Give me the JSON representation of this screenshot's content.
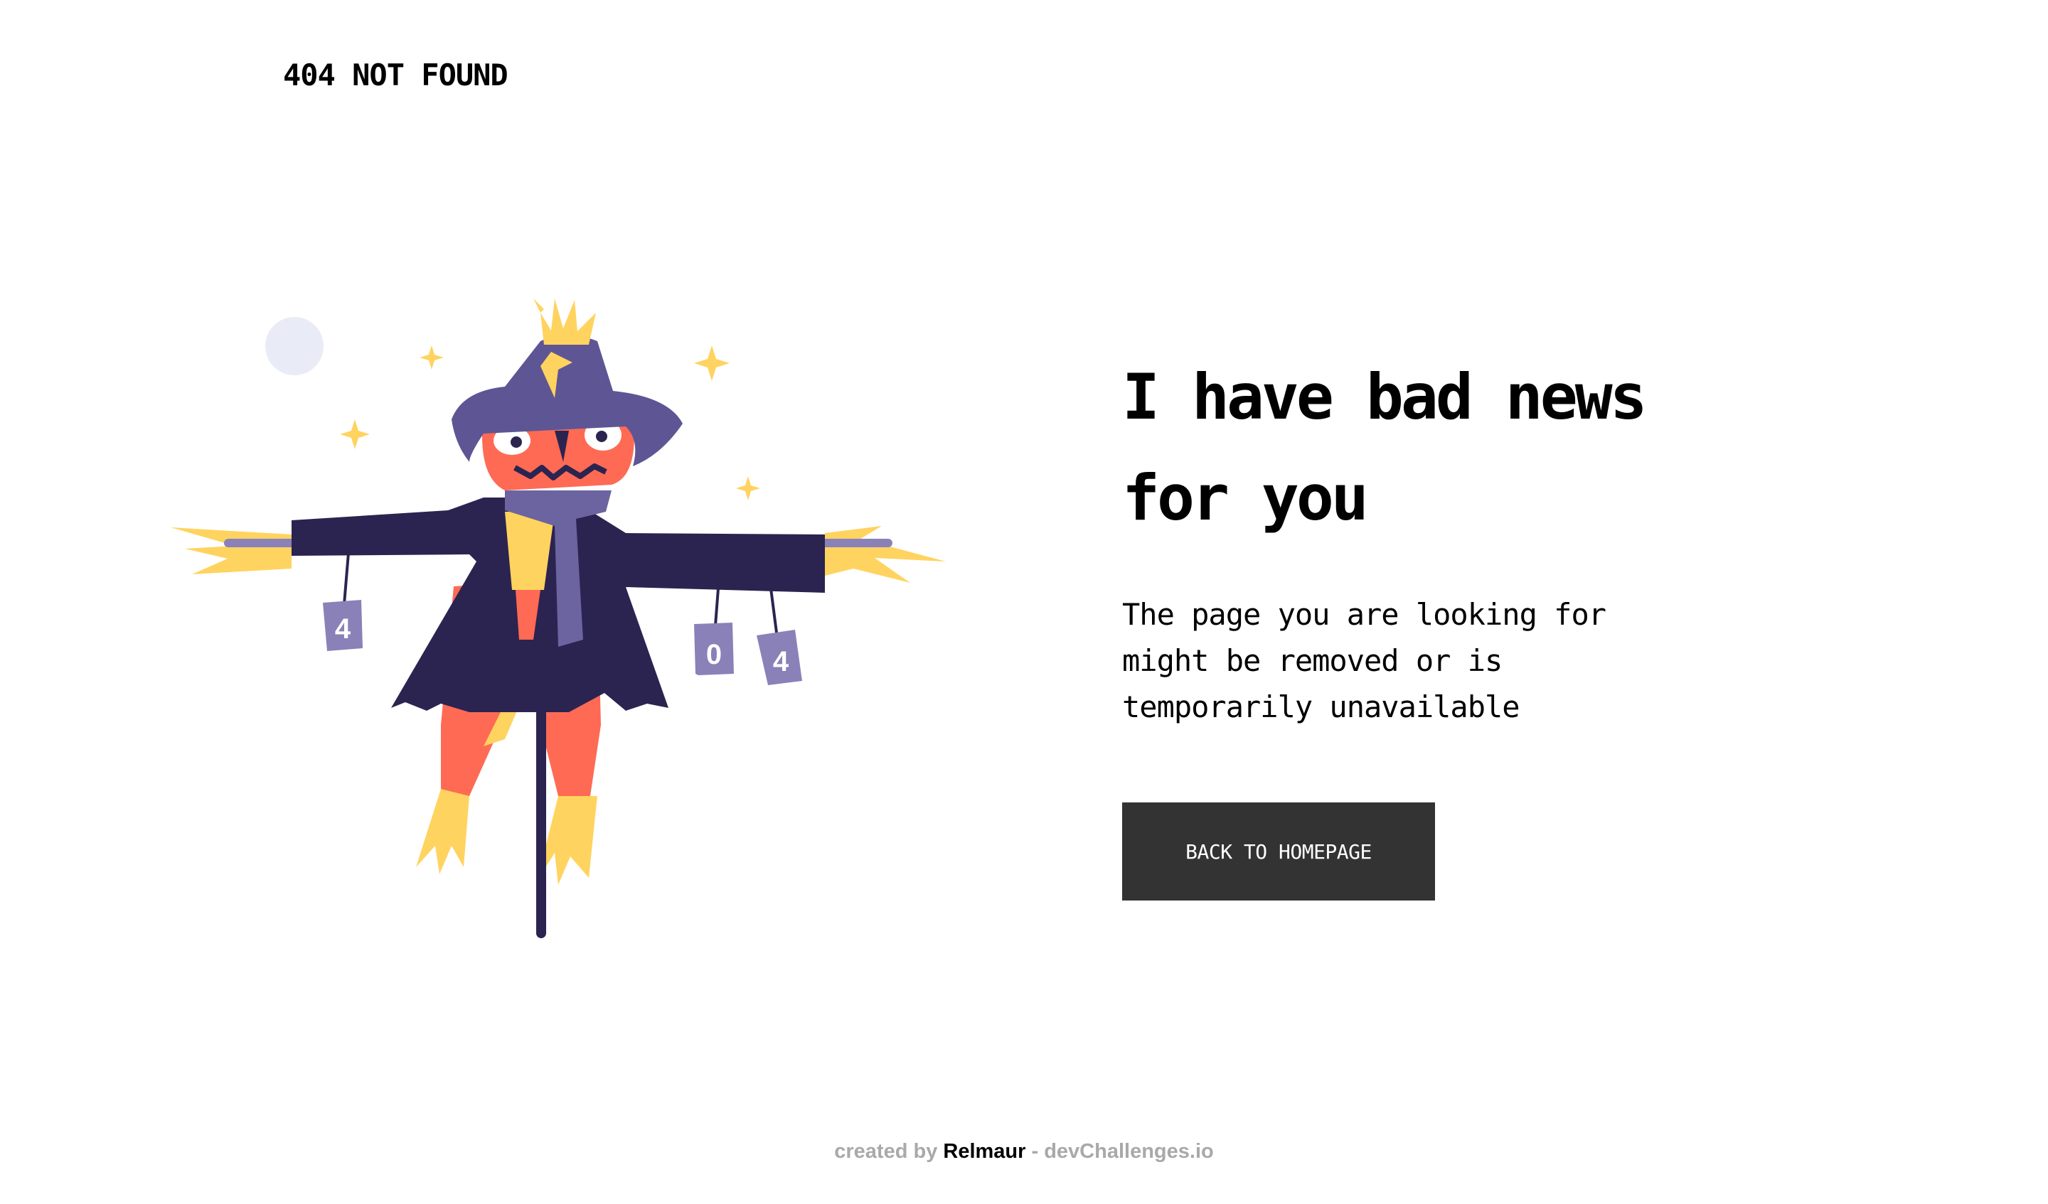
{
  "header": {
    "logo_text": "404 NOT FOUND"
  },
  "illustration": {
    "description_icon": "scarecrow-icon",
    "cans": [
      "4",
      "0",
      "4"
    ],
    "colors": {
      "coat": "#2B2450",
      "hat": "#5E5594",
      "face": "#FF6A55",
      "straw": "#FFD35F",
      "scarf": "#6C64A0",
      "cans": "#8A81B8",
      "moon": "#E9ECF6"
    }
  },
  "main": {
    "headline": "I have bad news for you",
    "message": "The page you are looking for might be removed or is temporarily unavailable",
    "button_label": "BACK TO HOMEPAGE"
  },
  "footer": {
    "prefix": "created by",
    "author": "Relmaur",
    "suffix": "- devChallenges.io"
  },
  "colors": {
    "button_bg": "#333333",
    "button_text": "#FFFFFF",
    "footer_muted": "#A9A9A9"
  }
}
